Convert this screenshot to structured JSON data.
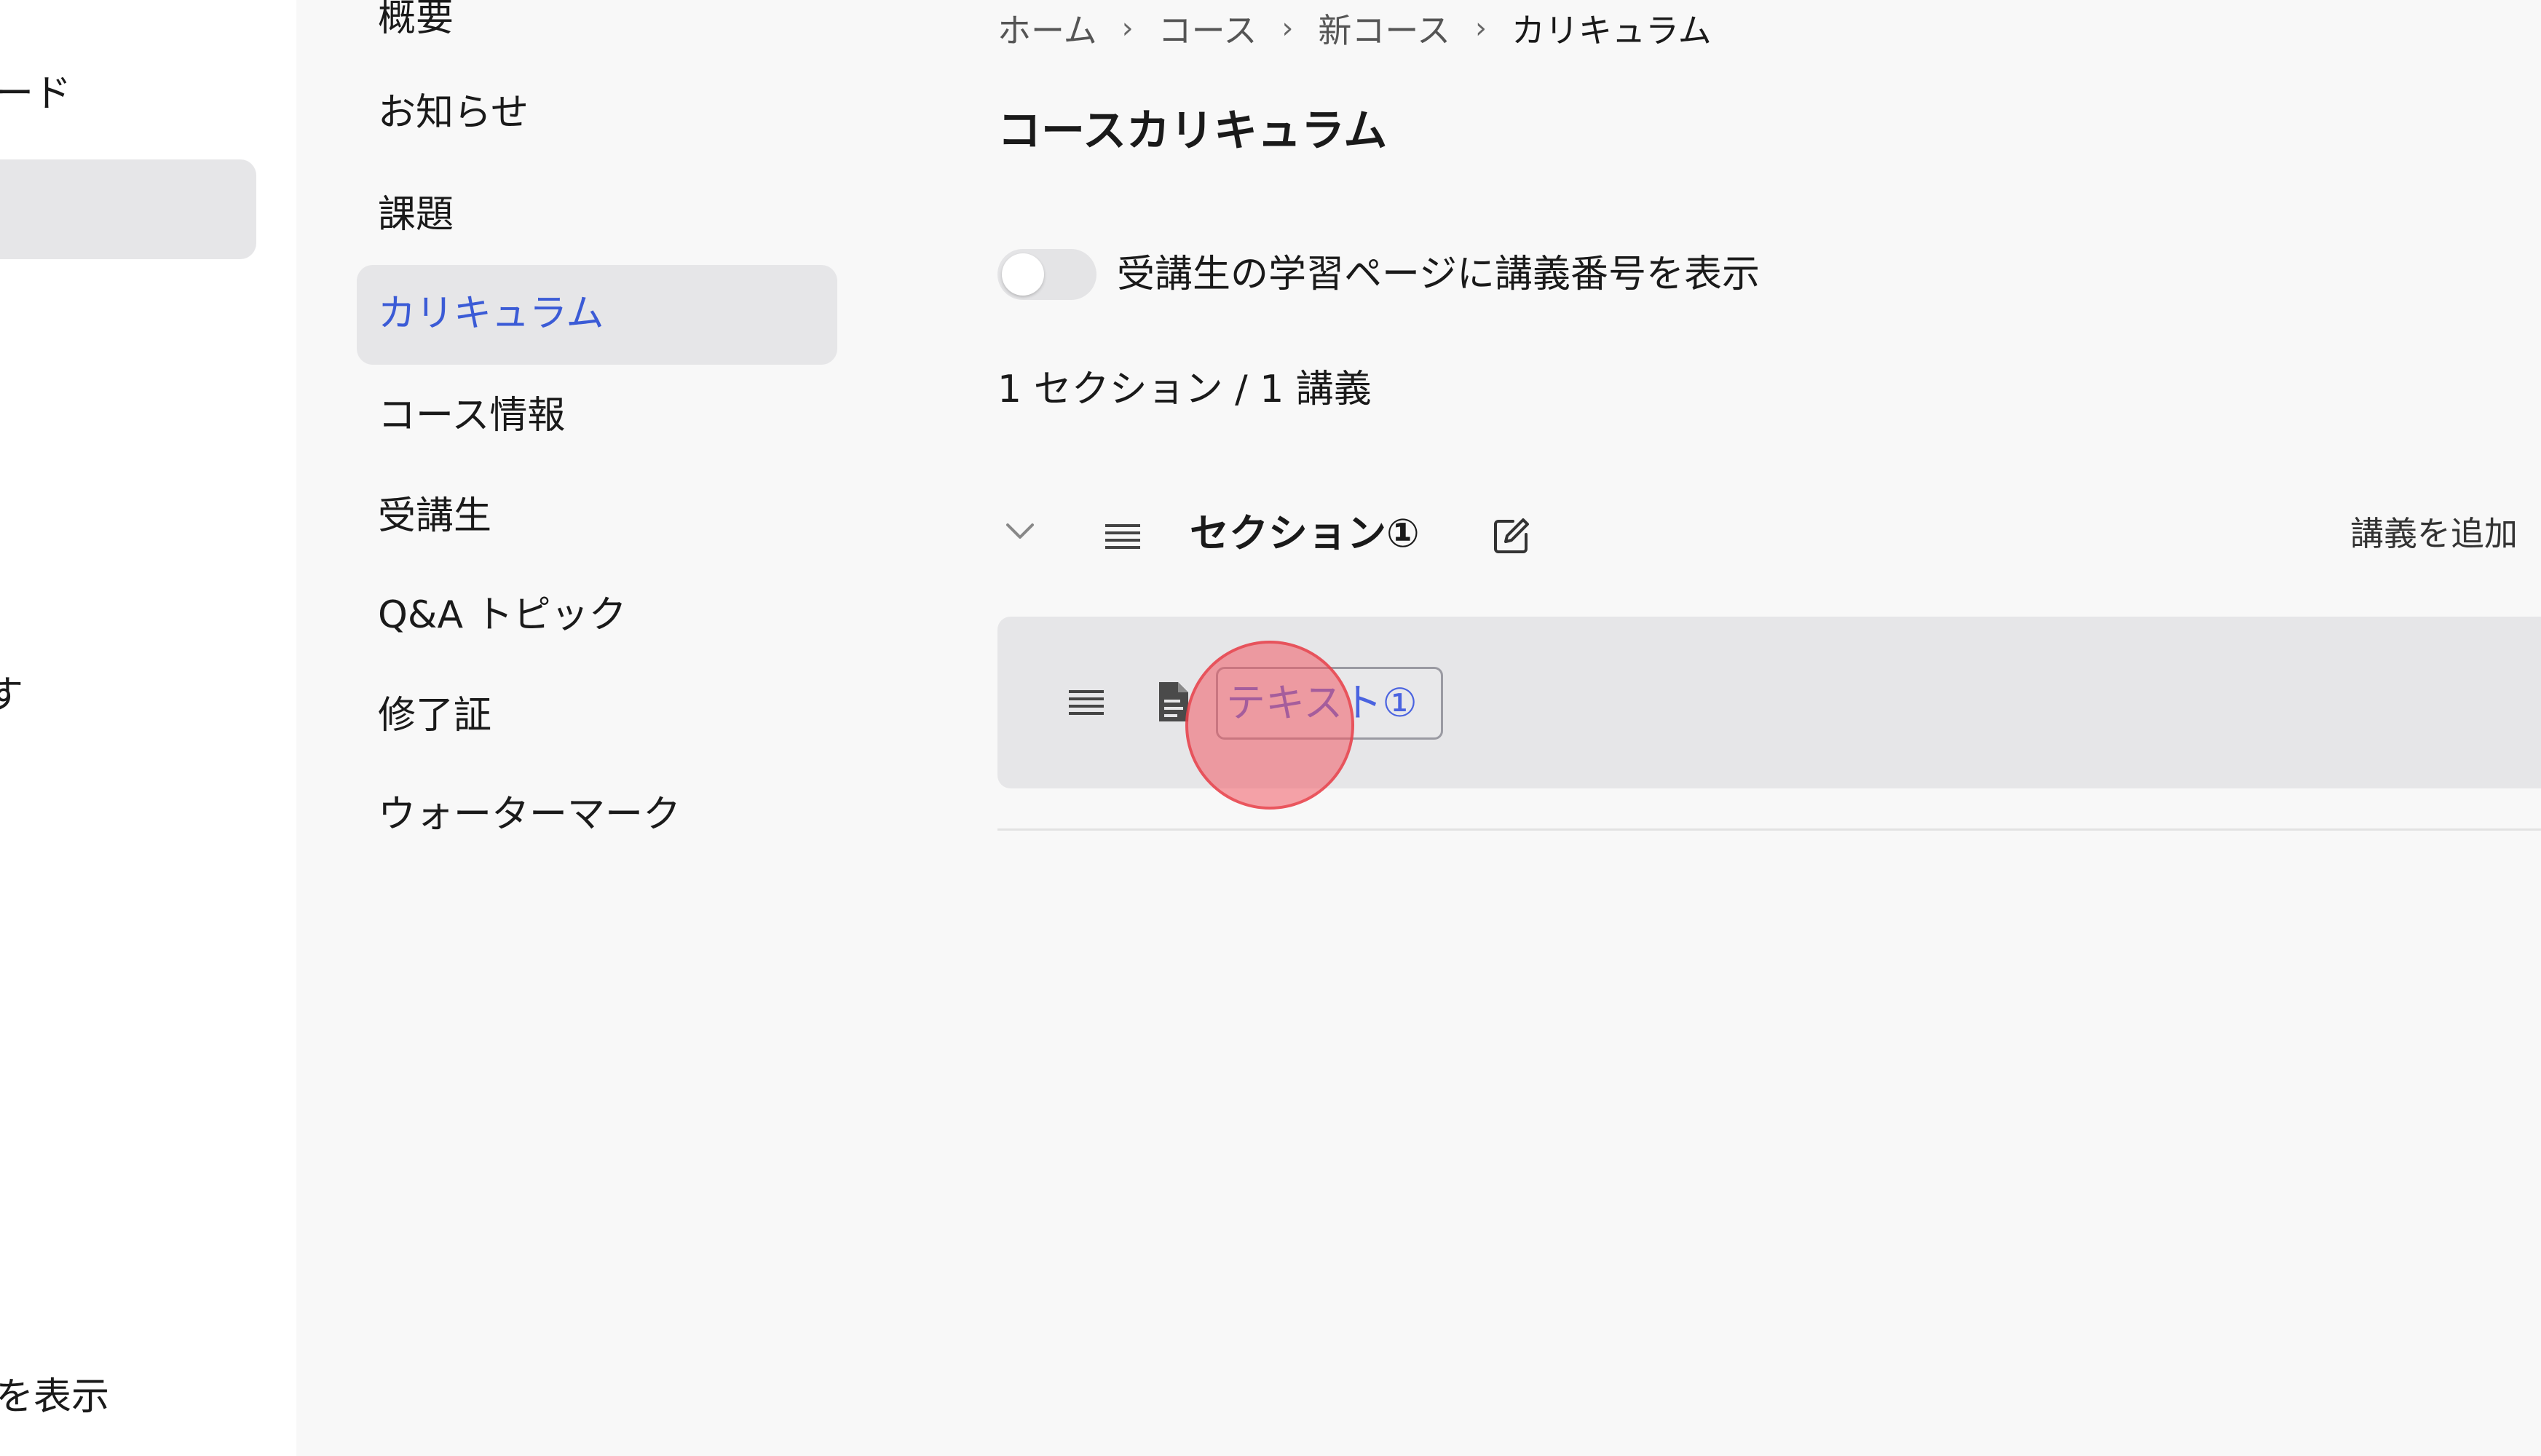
{
  "main_sidebar": {
    "item_partial_top": "ード",
    "item_partial_mid": "す",
    "item_partial_bottom": "を表示"
  },
  "course_menu": {
    "items": [
      {
        "label": "概要"
      },
      {
        "label": "お知らせ"
      },
      {
        "label": "課題"
      },
      {
        "label": "カリキュラム",
        "active": true
      },
      {
        "label": "コース情報"
      },
      {
        "label": "受講生"
      },
      {
        "label": "Q&A トピック"
      },
      {
        "label": "修了証"
      },
      {
        "label": "ウォーターマーク"
      }
    ]
  },
  "breadcrumb": [
    "ホーム",
    "コース",
    "新コース",
    "カリキュラム"
  ],
  "page": {
    "title": "コースカリキュラム",
    "toggle_label": "受講生の学習ページに講義番号を表示",
    "toggle_on": false,
    "summary": "1 セクション / 1 講義"
  },
  "section": {
    "title": "セクション①",
    "add_lecture_label": "講義を追加"
  },
  "lecture": {
    "title": "テキスト①"
  },
  "colors": {
    "accent": "#3b5bd6",
    "active_bg": "#e6e6e8",
    "click_marker": "#f05a64"
  }
}
